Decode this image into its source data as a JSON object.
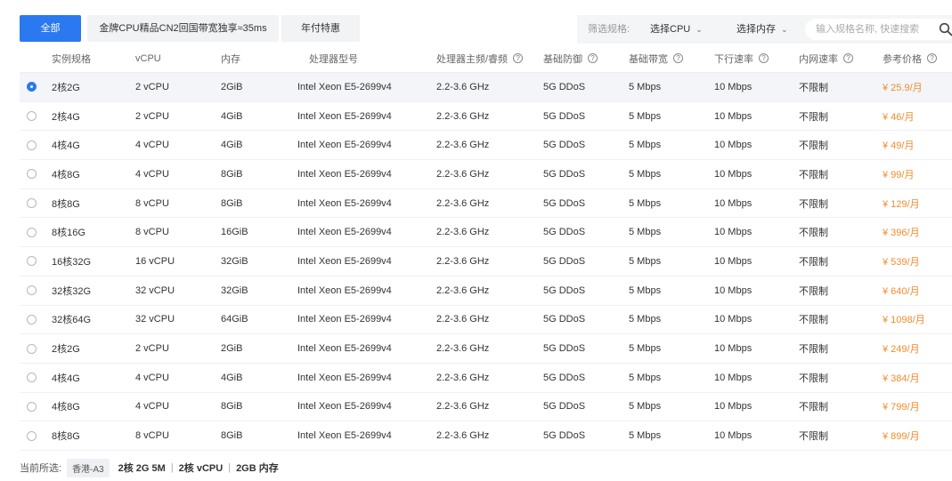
{
  "tabs": [
    {
      "label": "全部",
      "active": true
    },
    {
      "label": "金牌CPU精品CN2回国带宽独享≈35ms",
      "active": false
    },
    {
      "label": "年付特惠",
      "active": false
    }
  ],
  "filter": {
    "label": "筛选规格:",
    "cpu_select": "选择CPU",
    "mem_select": "选择内存",
    "search_placeholder": "输入规格名称, 快速搜索"
  },
  "table": {
    "headers": {
      "name": "实例规格",
      "vcpu": "vCPU",
      "mem": "内存",
      "proc": "处理器型号",
      "freq": "处理器主频/睿频",
      "ddos": "基础防御",
      "bw": "基础带宽",
      "down": "下行速率",
      "intra": "内网速率",
      "price": "参考价格"
    },
    "rows": [
      {
        "name": "2核2G",
        "vcpu": "2 vCPU",
        "mem": "2GiB",
        "proc": "Intel Xeon E5-2699v4",
        "freq": "2.2-3.6 GHz",
        "ddos": "5G DDoS",
        "bw": "5 Mbps",
        "down": "10 Mbps",
        "intra": "不限制",
        "price": "¥ 25.9/月",
        "selected": true
      },
      {
        "name": "2核4G",
        "vcpu": "2 vCPU",
        "mem": "4GiB",
        "proc": "Intel Xeon E5-2699v4",
        "freq": "2.2-3.6 GHz",
        "ddos": "5G DDoS",
        "bw": "5 Mbps",
        "down": "10 Mbps",
        "intra": "不限制",
        "price": "¥ 46/月",
        "selected": false
      },
      {
        "name": "4核4G",
        "vcpu": "4 vCPU",
        "mem": "4GiB",
        "proc": "Intel Xeon E5-2699v4",
        "freq": "2.2-3.6 GHz",
        "ddos": "5G DDoS",
        "bw": "5 Mbps",
        "down": "10 Mbps",
        "intra": "不限制",
        "price": "¥ 49/月",
        "selected": false
      },
      {
        "name": "4核8G",
        "vcpu": "4 vCPU",
        "mem": "8GiB",
        "proc": "Intel Xeon E5-2699v4",
        "freq": "2.2-3.6 GHz",
        "ddos": "5G DDoS",
        "bw": "5 Mbps",
        "down": "10 Mbps",
        "intra": "不限制",
        "price": "¥ 99/月",
        "selected": false
      },
      {
        "name": "8核8G",
        "vcpu": "8 vCPU",
        "mem": "8GiB",
        "proc": "Intel Xeon E5-2699v4",
        "freq": "2.2-3.6 GHz",
        "ddos": "5G DDoS",
        "bw": "5 Mbps",
        "down": "10 Mbps",
        "intra": "不限制",
        "price": "¥ 129/月",
        "selected": false
      },
      {
        "name": "8核16G",
        "vcpu": "8 vCPU",
        "mem": "16GiB",
        "proc": "Intel Xeon E5-2699v4",
        "freq": "2.2-3.6 GHz",
        "ddos": "5G DDoS",
        "bw": "5 Mbps",
        "down": "10 Mbps",
        "intra": "不限制",
        "price": "¥ 396/月",
        "selected": false
      },
      {
        "name": "16核32G",
        "vcpu": "16 vCPU",
        "mem": "32GiB",
        "proc": "Intel Xeon E5-2699v4",
        "freq": "2.2-3.6 GHz",
        "ddos": "5G DDoS",
        "bw": "5 Mbps",
        "down": "10 Mbps",
        "intra": "不限制",
        "price": "¥ 539/月",
        "selected": false
      },
      {
        "name": "32核32G",
        "vcpu": "32 vCPU",
        "mem": "32GiB",
        "proc": "Intel Xeon E5-2699v4",
        "freq": "2.2-3.6 GHz",
        "ddos": "5G DDoS",
        "bw": "5 Mbps",
        "down": "10 Mbps",
        "intra": "不限制",
        "price": "¥ 640/月",
        "selected": false
      },
      {
        "name": "32核64G",
        "vcpu": "32 vCPU",
        "mem": "64GiB",
        "proc": "Intel Xeon E5-2699v4",
        "freq": "2.2-3.6 GHz",
        "ddos": "5G DDoS",
        "bw": "5 Mbps",
        "down": "10 Mbps",
        "intra": "不限制",
        "price": "¥ 1098/月",
        "selected": false
      },
      {
        "name": "2核2G",
        "vcpu": "2 vCPU",
        "mem": "2GiB",
        "proc": "Intel Xeon E5-2699v4",
        "freq": "2.2-3.6 GHz",
        "ddos": "5G DDoS",
        "bw": "5 Mbps",
        "down": "10 Mbps",
        "intra": "不限制",
        "price": "¥ 249/月",
        "selected": false
      },
      {
        "name": "4核4G",
        "vcpu": "4 vCPU",
        "mem": "4GiB",
        "proc": "Intel Xeon E5-2699v4",
        "freq": "2.2-3.6 GHz",
        "ddos": "5G DDoS",
        "bw": "5 Mbps",
        "down": "10 Mbps",
        "intra": "不限制",
        "price": "¥ 384/月",
        "selected": false
      },
      {
        "name": "4核8G",
        "vcpu": "4 vCPU",
        "mem": "8GiB",
        "proc": "Intel Xeon E5-2699v4",
        "freq": "2.2-3.6 GHz",
        "ddos": "5G DDoS",
        "bw": "5 Mbps",
        "down": "10 Mbps",
        "intra": "不限制",
        "price": "¥ 799/月",
        "selected": false
      },
      {
        "name": "8核8G",
        "vcpu": "8 vCPU",
        "mem": "8GiB",
        "proc": "Intel Xeon E5-2699v4",
        "freq": "2.2-3.6 GHz",
        "ddos": "5G DDoS",
        "bw": "5 Mbps",
        "down": "10 Mbps",
        "intra": "不限制",
        "price": "¥ 899/月",
        "selected": false
      }
    ]
  },
  "footer": {
    "label": "当前所选:",
    "region": "香港-A3",
    "spec": "2核 2G 5M",
    "vcpu": "2核 vCPU",
    "mem": "2GB 内存",
    "separator": "|"
  },
  "colors": {
    "accent": "#2b79f0",
    "price": "#f08b2d",
    "selected_row": "#f3f5f8"
  }
}
